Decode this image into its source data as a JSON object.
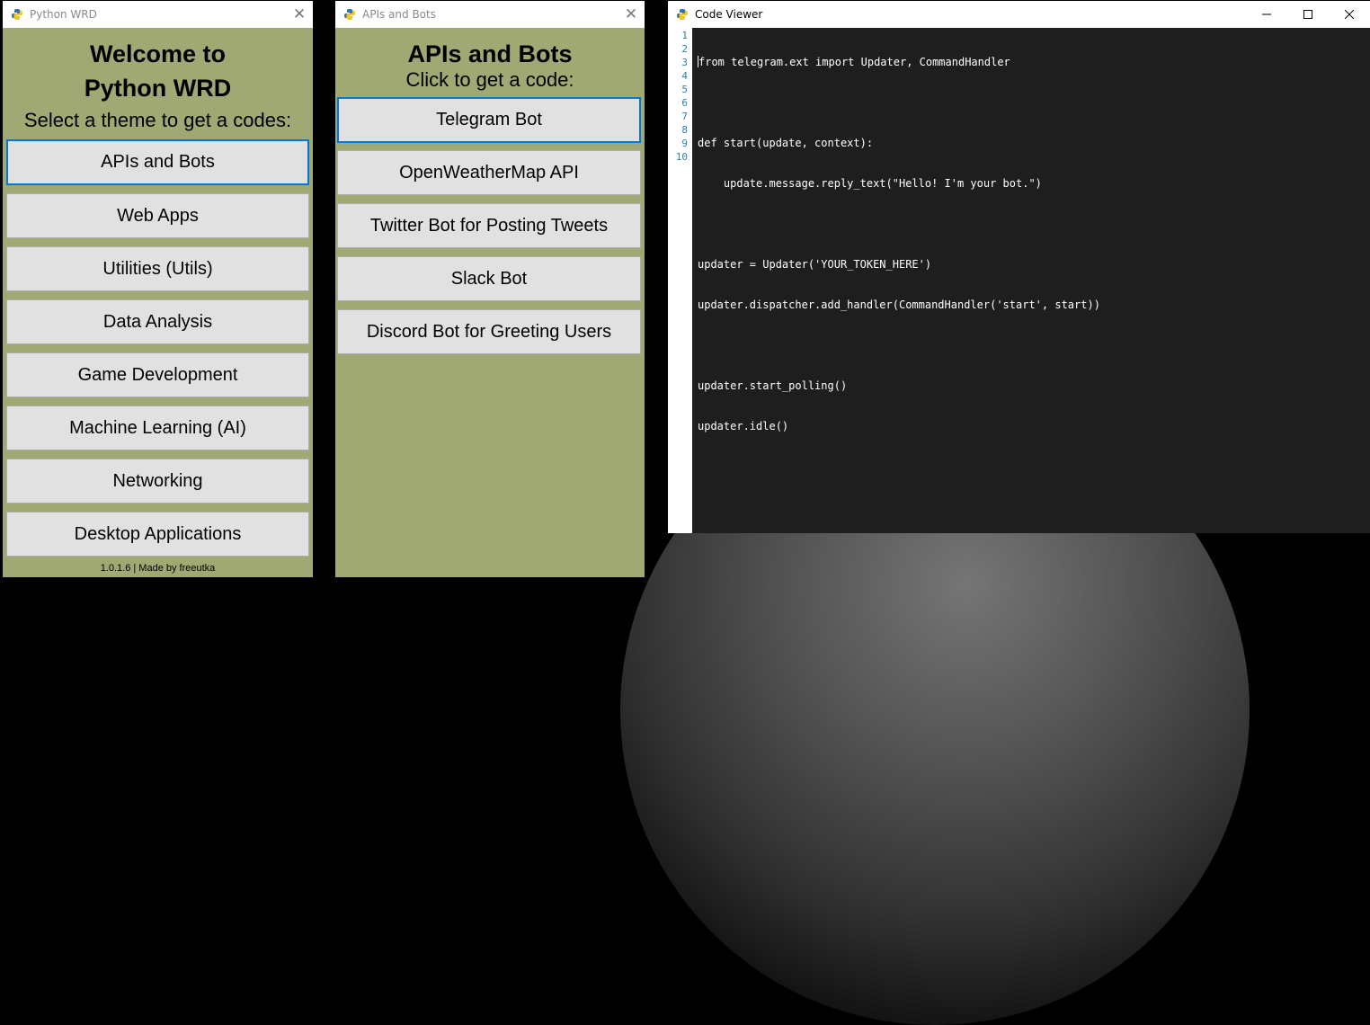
{
  "window_main": {
    "title": "Python WRD",
    "heading_line1": "Welcome to",
    "heading_line2": "Python WRD",
    "subtitle": "Select a theme to get a codes:",
    "buttons": [
      "APIs and Bots",
      "Web Apps",
      "Utilities (Utils)",
      "Data Analysis",
      "Game Development",
      "Machine Learning (AI)",
      "Networking",
      "Desktop Applications"
    ],
    "footer": "1.0.1.6 | Made by freeutka"
  },
  "window_apis": {
    "title": "APIs and Bots",
    "heading": "APIs and Bots",
    "subtitle": "Click to get a code:",
    "buttons": [
      "Telegram Bot",
      "OpenWeatherMap API",
      "Twitter Bot for Posting Tweets",
      "Slack Bot",
      "Discord Bot for Greeting Users"
    ]
  },
  "window_code": {
    "title": "Code Viewer",
    "line_numbers": [
      "1",
      "2",
      "3",
      "4",
      "5",
      "6",
      "7",
      "8",
      "9",
      "10"
    ],
    "lines": [
      "from telegram.ext import Updater, CommandHandler",
      "",
      "def start(update, context):",
      "    update.message.reply_text(\"Hello! I'm your bot.\")",
      "",
      "updater = Updater('YOUR_TOKEN_HERE')",
      "updater.dispatcher.add_handler(CommandHandler('start', start))",
      "",
      "updater.start_polling()",
      "updater.idle()"
    ]
  },
  "icons": {
    "app": "python-icon",
    "close": "close-icon",
    "minimize": "minimize-icon",
    "maximize": "maximize-icon"
  },
  "colors": {
    "panel_bg": "#a0a874",
    "button_bg": "#e1e1e1",
    "focus_border": "#0078d7",
    "editor_bg": "#1e1e1e",
    "line_number": "#2b7fb2"
  }
}
